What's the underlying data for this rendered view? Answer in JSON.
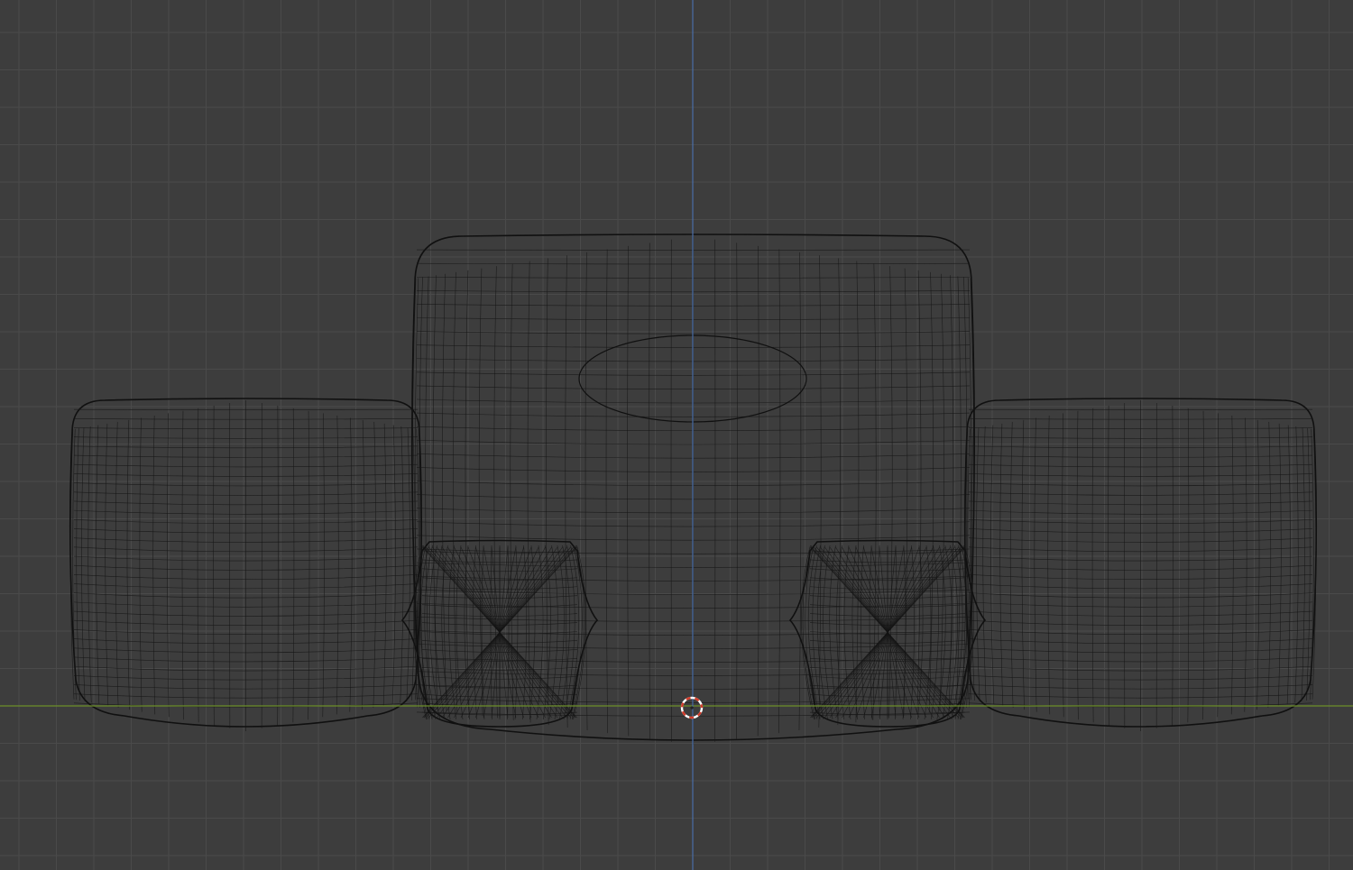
{
  "viewport": {
    "background": "#3d3d3d",
    "grid_color": "#4a4a4a",
    "wire_color": "#111111",
    "x_axis_color": "#6c8e2a",
    "z_axis_color": "#4a6fa8"
  },
  "scene": {
    "objects": [
      {
        "name": "center-body",
        "shape": "rounded-box"
      },
      {
        "name": "left-cushion",
        "shape": "rounded-box"
      },
      {
        "name": "right-cushion",
        "shape": "rounded-box"
      },
      {
        "name": "left-small-cylinder",
        "shape": "bulged-cylinder"
      },
      {
        "name": "right-small-cylinder",
        "shape": "bulged-cylinder"
      },
      {
        "name": "center-ellipse",
        "shape": "ellipse"
      }
    ]
  },
  "cursor": {
    "icon": "3d-cursor-icon",
    "colors": [
      "#d33b2a",
      "#ffffff"
    ]
  }
}
